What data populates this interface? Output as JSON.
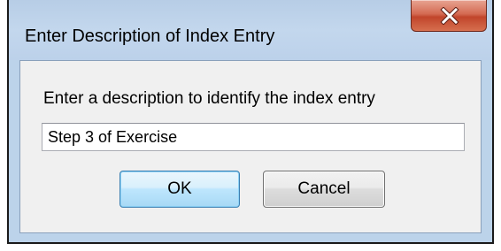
{
  "window": {
    "title": "Enter Description of Index Entry",
    "close_icon": "close-x-icon"
  },
  "dialog": {
    "prompt": "Enter a description to identify the index entry",
    "description_value": "Step 3 of Exercise",
    "ok_label": "OK",
    "cancel_label": "Cancel"
  },
  "colors": {
    "frame": "#bcd3ea",
    "client": "#f0f0f0",
    "close_button": "#c7492e",
    "default_button_border": "#3c7fb1"
  }
}
